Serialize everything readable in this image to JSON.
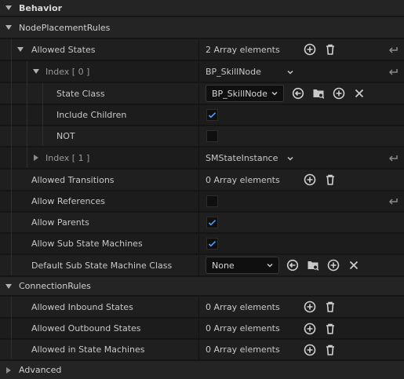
{
  "sections": {
    "behavior": "Behavior",
    "node_placement_rules": "NodePlacementRules",
    "connection_rules": "ConnectionRules",
    "advanced": "Advanced"
  },
  "props": {
    "allowed_states": {
      "label": "Allowed States",
      "value": "2 Array elements"
    },
    "index0": {
      "label": "Index [ 0 ]",
      "value": "BP_SkillNode"
    },
    "state_class": {
      "label": "State Class",
      "value": "BP_SkillNode"
    },
    "include_children": {
      "label": "Include Children",
      "checked": true
    },
    "not": {
      "label": "NOT",
      "checked": false
    },
    "index1": {
      "label": "Index [ 1 ]",
      "value": "SMStateInstance"
    },
    "allowed_transitions": {
      "label": "Allowed Transitions",
      "value": "0 Array elements"
    },
    "allow_references": {
      "label": "Allow References",
      "checked": false
    },
    "allow_parents": {
      "label": "Allow Parents",
      "checked": true
    },
    "allow_sub_state_machines": {
      "label": "Allow Sub State Machines",
      "checked": true
    },
    "default_sub_sm_class": {
      "label": "Default Sub State Machine Class",
      "value": "None"
    },
    "allowed_inbound": {
      "label": "Allowed Inbound States",
      "value": "0 Array elements"
    },
    "allowed_outbound": {
      "label": "Allowed Outbound States",
      "value": "0 Array elements"
    },
    "allowed_in_sm": {
      "label": "Allowed in State Machines",
      "value": "0 Array elements"
    }
  },
  "colors": {
    "check": "#4a9eff",
    "bg": "#151515",
    "category": "#242424",
    "row": "#1f1f1f"
  },
  "icons": [
    "chevron-down-icon",
    "add-icon",
    "trash-icon",
    "reset-arrow-icon",
    "use-selected-icon",
    "browse-icon",
    "clear-icon",
    "checkmark-icon"
  ]
}
